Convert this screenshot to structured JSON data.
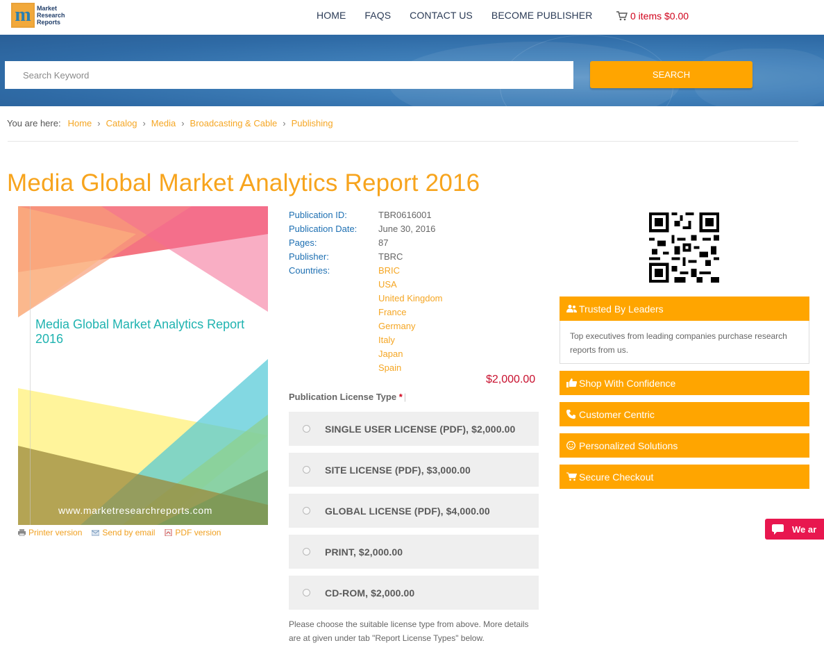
{
  "header": {
    "logo_lines": [
      "Market",
      "Research",
      "Reports"
    ],
    "logo_letter": "m",
    "nav": [
      "HOME",
      "FAQS",
      "CONTACT US",
      "BECOME PUBLISHER"
    ],
    "cart_text": "0 items $0.00"
  },
  "search": {
    "placeholder": "Search Keyword",
    "button": "SEARCH"
  },
  "breadcrumb": {
    "lead": "You are here:",
    "items": [
      "Home",
      "Catalog",
      "Media",
      "Broadcasting & Cable",
      "Publishing"
    ]
  },
  "title": "Media Global Market Analytics Report 2016",
  "cover": {
    "title": "Media Global Market Analytics Report 2016",
    "url": "www.marketresearchreports.com"
  },
  "actions": [
    "Printer version",
    "Send by email",
    "PDF version"
  ],
  "info": {
    "publication_id_label": "Publication ID:",
    "publication_id": "TBR0616001",
    "publication_date_label": "Publication Date:",
    "publication_date": "June 30, 2016",
    "pages_label": "Pages:",
    "pages": "87",
    "publisher_label": "Publisher:",
    "publisher": "TBRC",
    "countries_label": "Countries:",
    "countries": [
      "BRIC",
      "USA",
      "United Kingdom",
      "France",
      "Germany",
      "Italy",
      "Japan",
      "Spain"
    ]
  },
  "price": "$2,000.00",
  "license": {
    "label": "Publication License Type",
    "required": "*",
    "options": [
      "SINGLE USER LICENSE (PDF), $2,000.00",
      "SITE LICENSE (PDF), $3,000.00",
      "GLOBAL LICENSE (PDF), $4,000.00",
      "PRINT, $2,000.00",
      "CD-ROM, $2,000.00"
    ],
    "note": "Please choose the suitable license type from above. More details are at given under tab \"Report License Types\" below."
  },
  "sidebar": {
    "trusted_title": "Trusted By Leaders",
    "trusted_body": "Top executives from leading companies purchase research reports from us.",
    "panels": [
      "Shop With Confidence",
      "Customer Centric",
      "Personalized Solutions",
      "Secure Checkout"
    ]
  },
  "chat": {
    "label": "We ar"
  },
  "colors": {
    "accent": "#ffa500",
    "link_orange": "#f5a623",
    "info_blue": "#1d6fb2",
    "price_red": "#c8102e",
    "chat_pink": "#e8174f"
  }
}
